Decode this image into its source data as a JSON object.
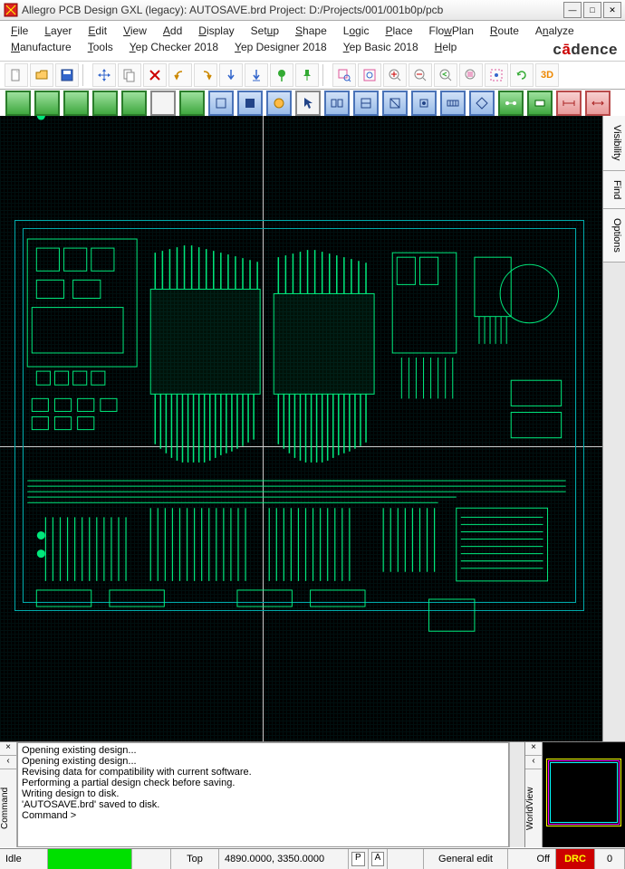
{
  "window": {
    "title": "Allegro PCB Design GXL (legacy): AUTOSAVE.brd   Project: D:/Projects/001/001b0p/pcb"
  },
  "menu": {
    "items": [
      "File",
      "Layer",
      "Edit",
      "View",
      "Add",
      "Display",
      "Setup",
      "Shape",
      "Logic",
      "Place",
      "FlowPlan",
      "Route",
      "Analyze",
      "Manufacture",
      "Tools",
      "Yep Checker 2018",
      "Yep Designer 2018",
      "Yep Basic 2018",
      "Help"
    ]
  },
  "brand": {
    "text": "cādence"
  },
  "side_tabs": {
    "items": [
      "Visibility",
      "Find",
      "Options"
    ]
  },
  "command_log": {
    "label": "Command",
    "lines": [
      "Opening existing design...",
      "Opening existing design...",
      "Revising data for compatibility with current software.",
      "Performing a partial design check before saving.",
      "Writing design to disk.",
      "'AUTOSAVE.brd' saved to disk.",
      "Command >"
    ]
  },
  "worldview": {
    "label": "WorldView"
  },
  "status": {
    "mode": "Idle",
    "layer": "Top",
    "coords": "4890.0000, 3350.0000",
    "p": "P",
    "a": "A",
    "edit_mode": "General edit",
    "drc_mode": "Off",
    "drc": "DRC",
    "count": "0"
  },
  "toolbar1_icons": [
    "new-file",
    "open-file",
    "save-file",
    "move",
    "copy",
    "delete",
    "undo",
    "redo",
    "arrow-down",
    "arrow-down-bar",
    "pin",
    "pushpin",
    "zoom-window",
    "zoom-fit",
    "zoom-in",
    "zoom-out",
    "zoom-prev",
    "zoom-sel",
    "zoom-world",
    "refresh",
    "3d"
  ],
  "toolbar2_icons": [
    "layer-top",
    "layer-2",
    "layer-3",
    "layer-4",
    "layer-5",
    "layer-blank",
    "layer-bot",
    "sep",
    "shape1",
    "shape2",
    "shape3",
    "arrow",
    "tool1",
    "tool2",
    "tool3",
    "tool4",
    "tool5",
    "tool6",
    "sep",
    "net1",
    "net2",
    "dim1",
    "dim2"
  ]
}
